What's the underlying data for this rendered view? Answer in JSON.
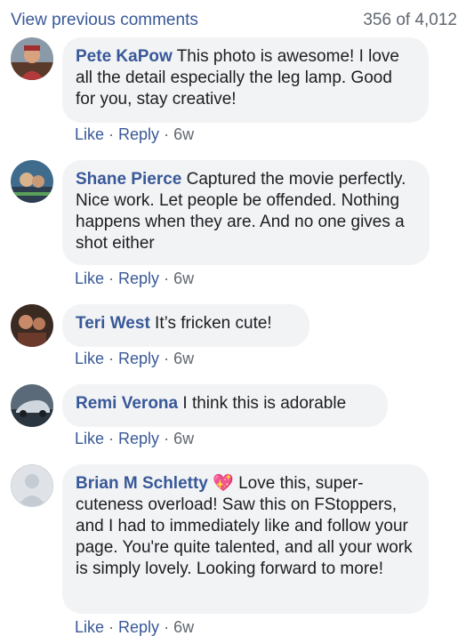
{
  "header": {
    "view_previous": "View previous comments",
    "count": "356 of 4,012"
  },
  "actions": {
    "like": "Like",
    "reply": "Reply",
    "sep": "·"
  },
  "comments": [
    {
      "author": "Pete KaPow",
      "text": "This photo is awesome! I love all the detail especially the leg lamp. Good for you, stay creative!",
      "time": "6w",
      "avatar_colors": [
        "#8a9aa8",
        "#b23a3a",
        "#5a3a2a"
      ]
    },
    {
      "author": "Shane Pierce",
      "text": "Captured the movie perfectly. Nice work. Let people be offended. Nothing happens when they are. And no one gives a shot either",
      "time": "6w",
      "avatar_colors": [
        "#2c3e50",
        "#3f6b8c",
        "#d9b38c"
      ]
    },
    {
      "author": "Teri West",
      "text": "It’s fricken cute!",
      "time": "6w",
      "avatar_colors": [
        "#6b3a2a",
        "#c98a6a",
        "#3a2a22"
      ]
    },
    {
      "author": "Remi Verona",
      "text": "I think this is adorable",
      "time": "6w",
      "avatar_colors": [
        "#5a6a78",
        "#cfd6de",
        "#2a3540"
      ]
    },
    {
      "author": "Brian M Schletty",
      "badge": "💖",
      "text": "Love this, super-cuteness overload! Saw this on FStoppers, and I had to immediately like and follow your page. You're quite talented, and all your work is simply lovely. Looking forward to more!",
      "time": "6w",
      "avatar_colors": [
        "#dfe3e8",
        "#c5cbd3",
        "#c5cbd3"
      ]
    }
  ]
}
